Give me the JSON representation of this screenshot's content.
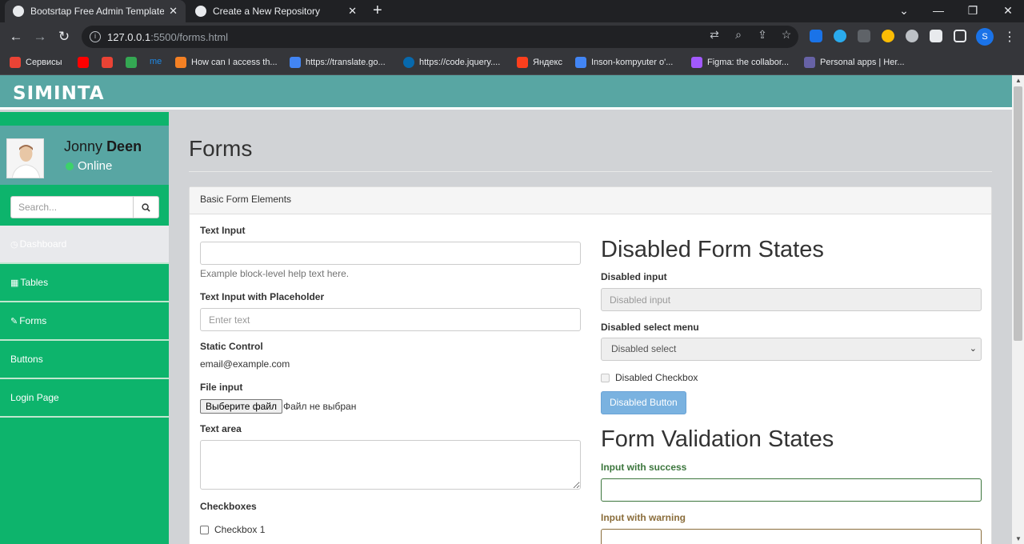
{
  "browser": {
    "tabs": [
      {
        "title": "Bootsrtap Free Admin Template - ",
        "active": true
      },
      {
        "title": "Create a New Repository",
        "active": false
      }
    ],
    "url_host": "127.0.0.1",
    "url_path": ":5500/forms.html",
    "bookmarks": [
      {
        "label": "Сервисы",
        "color": "#ea4335"
      },
      {
        "label": "",
        "color": "#ff0000"
      },
      {
        "label": "",
        "color": "#ea4335"
      },
      {
        "label": "",
        "color": "#34a853"
      },
      {
        "label": "me",
        "color": "#1e88e5"
      },
      {
        "label": "How can I access th...",
        "color": "#f48024"
      },
      {
        "label": "https://translate.go...",
        "color": "#4285f4"
      },
      {
        "label": "https://code.jquery....",
        "color": "#0769ad"
      },
      {
        "label": "Яндекс",
        "color": "#fc3f1d"
      },
      {
        "label": "Inson-kompyuter o'...",
        "color": "#4285f4"
      },
      {
        "label": "Figma: the collabor...",
        "color": "#a259ff"
      },
      {
        "label": "Personal apps | Her...",
        "color": "#6762a6"
      }
    ],
    "profile_initial": "S"
  },
  "app": {
    "brand": "SIMINTA",
    "user_first": "Jonny",
    "user_last": "Deen",
    "status": "Online",
    "search_placeholder": "Search...",
    "nav": [
      {
        "label": "Dashboard",
        "icon": "dashboard-icon",
        "active": true
      },
      {
        "label": "Tables",
        "icon": "table-icon",
        "active": false
      },
      {
        "label": "Forms",
        "icon": "edit-icon",
        "active": false
      },
      {
        "label": "Buttons",
        "icon": "",
        "active": false
      },
      {
        "label": "Login Page",
        "icon": "",
        "active": false
      }
    ]
  },
  "page": {
    "title": "Forms",
    "panel_heading": "Basic Form Elements",
    "left": {
      "text_input_label": "Text Input",
      "text_input_help": "Example block-level help text here.",
      "placeholder_label": "Text Input with Placeholder",
      "placeholder_value": "Enter text",
      "static_label": "Static Control",
      "static_value": "email@example.com",
      "file_label": "File input",
      "file_button": "Выберите файл",
      "file_status": "Файл не выбран",
      "textarea_label": "Text area",
      "checkboxes_label": "Checkboxes",
      "checkbox_1": "Checkbox 1"
    },
    "right": {
      "disabled_heading": "Disabled Form States",
      "disabled_input_label": "Disabled input",
      "disabled_input_placeholder": "Disabled input",
      "disabled_select_label": "Disabled select menu",
      "disabled_select_value": "Disabled select",
      "disabled_checkbox": "Disabled Checkbox",
      "disabled_button": "Disabled Button",
      "validation_heading": "Form Validation States",
      "success_label": "Input with success",
      "warning_label": "Input with warning",
      "success_color": "#3c763d",
      "warning_color": "#8a6d3b"
    }
  }
}
